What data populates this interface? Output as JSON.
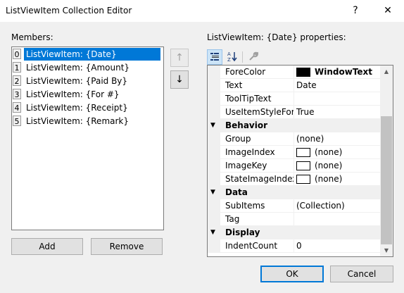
{
  "window": {
    "title": "ListViewItem Collection Editor",
    "help_glyph": "?",
    "close_glyph": "✕"
  },
  "members": {
    "label": "Members:",
    "items": [
      {
        "index": "0",
        "label": "ListViewItem: {Date}",
        "selected": true
      },
      {
        "index": "1",
        "label": "ListViewItem: {Amount}",
        "selected": false
      },
      {
        "index": "2",
        "label": "ListViewItem: {Paid By}",
        "selected": false
      },
      {
        "index": "3",
        "label": "ListViewItem: {For #}",
        "selected": false
      },
      {
        "index": "4",
        "label": "ListViewItem: {Receipt}",
        "selected": false
      },
      {
        "index": "5",
        "label": "ListViewItem: {Remark}",
        "selected": false
      }
    ],
    "move_up_glyph": "↑",
    "move_down_glyph": "↓",
    "add_label": "Add",
    "remove_label": "Remove"
  },
  "properties": {
    "label": "ListViewItem: {Date} properties:",
    "toolbar": {
      "categorized_icon": "categorized-icon",
      "alphabetical_icon": "alphabetical-icon",
      "property_pages_icon": "wrench-icon"
    },
    "rows": [
      {
        "kind": "prop",
        "name": "ForeColor",
        "value": "WindowText",
        "swatch": "#000000",
        "bold": true
      },
      {
        "kind": "prop",
        "name": "Text",
        "value": "Date"
      },
      {
        "kind": "prop",
        "name": "ToolTipText",
        "value": ""
      },
      {
        "kind": "prop",
        "name": "UseItemStyleForSu",
        "value": "True"
      },
      {
        "kind": "cat",
        "name": "Behavior"
      },
      {
        "kind": "prop",
        "name": "Group",
        "value": "(none)"
      },
      {
        "kind": "prop",
        "name": "ImageIndex",
        "value": "(none)",
        "swatch": "#ffffff"
      },
      {
        "kind": "prop",
        "name": "ImageKey",
        "value": "(none)",
        "swatch": "#ffffff"
      },
      {
        "kind": "prop",
        "name": "StateImageIndex",
        "value": "(none)",
        "swatch": "#ffffff"
      },
      {
        "kind": "cat",
        "name": "Data"
      },
      {
        "kind": "prop",
        "name": "SubItems",
        "value": "(Collection)"
      },
      {
        "kind": "prop",
        "name": "Tag",
        "value": ""
      },
      {
        "kind": "cat",
        "name": "Display"
      },
      {
        "kind": "prop",
        "name": "IndentCount",
        "value": "0"
      }
    ]
  },
  "footer": {
    "ok_label": "OK",
    "cancel_label": "Cancel"
  },
  "colors": {
    "selection": "#0078d7",
    "default_button_border": "#0078d7"
  }
}
